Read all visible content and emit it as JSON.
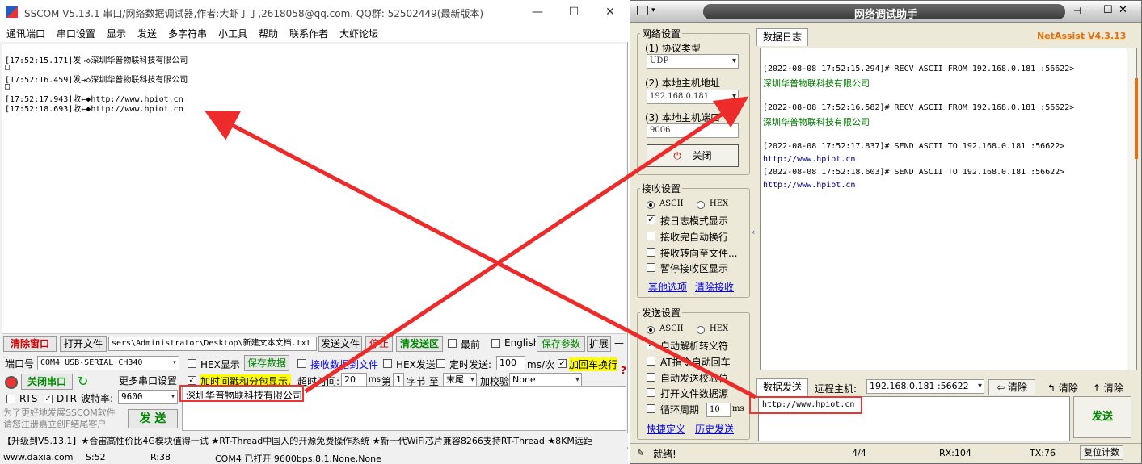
{
  "sscom": {
    "title": "SSCOM V5.13.1 串口/网络数据调试器,作者:大虾丁丁,2618058@qq.com. QQ群: 52502449(最新版本)",
    "menu": [
      "通讯端口",
      "串口设置",
      "显示",
      "发送",
      "多字符串",
      "小工具",
      "帮助",
      "联系作者",
      "大虾论坛"
    ],
    "recv_lines": [
      "[17:52:15.171]发→◇深圳华普物联科技有限公司",
      "□",
      "[17:52:16.459]发→◇深圳华普物联科技有限公司",
      "□",
      "[17:52:17.943]收←◆http://www.hpiot.cn",
      "[17:52:18.693]收←◆http://www.hpiot.cn"
    ],
    "toolbar": {
      "clear_window": "清除窗口",
      "open_file": "打开文件",
      "file_path": "sers\\Administrator\\Desktop\\新建文本文档.txt",
      "send_file": "发送文件",
      "stop": "停止",
      "clear_send": "清发送区",
      "topmost": "最前",
      "english": "English",
      "save_params": "保存参数",
      "expand": "扩展",
      "dash": "—"
    },
    "port": {
      "label": "端口号",
      "value": "COM4 USB-SERIAL CH340",
      "close_port": "关闭串口",
      "more_settings": "更多串口设置",
      "rts": "RTS",
      "dtr": "DTR",
      "baud_label": "波特率:",
      "baud": "9600"
    },
    "options": {
      "hex_display": "HEX显示",
      "save_data": "保存数据",
      "recv_to_file": "接收数据到文件",
      "hex_send": "HEX发送",
      "timed_send": "定时发送:",
      "timed_value": "100",
      "ms_per": "ms/次",
      "add_crlf": "加回车换行",
      "add_timestamp": "加时间戳和分包显示,",
      "timeout_label": "超时时间:",
      "timeout_value": "20",
      "ms": "ms",
      "nth": "第",
      "byte_n": "1",
      "byte_to": "字节 至",
      "end": "末尾",
      "checksum": "加校验",
      "checksum_value": "None",
      "question": "?"
    },
    "send_text": "深圳华普物联科技有限公司",
    "promo_left": "为了更好地发展SSCOM软件\n请您注册嘉立创F结尾客户",
    "send_button": "发 送",
    "ticker": "【升级到V5.13.1】★合宙高性价比4G模块值得一试 ★RT-Thread中国人的开源免费操作系统 ★新一代WiFi芯片兼容8266支持RT-Thread ★8KM远距",
    "status": {
      "site": "www.daxia.com",
      "s": "S:52",
      "r": "R:38",
      "port_state": "COM4 已打开  9600bps,8,1,None,None"
    }
  },
  "netassist": {
    "title": "网络调试助手",
    "net_settings": {
      "group": "网络设置",
      "protocol_label": "(1) 协议类型",
      "protocol": "UDP",
      "host_label": "(2) 本地主机地址",
      "host": "192.168.0.181",
      "port_label": "(3) 本地主机端口",
      "port": "9006",
      "close": "关闭"
    },
    "recv_settings": {
      "group": "接收设置",
      "ascii": "ASCII",
      "hex": "HEX",
      "log_mode": "按日志模式显示",
      "auto_newline": "接收完自动换行",
      "to_file": "接收转向至文件...",
      "pause": "暂停接收区显示",
      "more": "其他选项",
      "clear": "清除接收"
    },
    "send_settings": {
      "group": "发送设置",
      "ascii": "ASCII",
      "hex": "HEX",
      "escape": "自动解析转义符",
      "at_newline": "AT指令自动回车",
      "checksum": "自动发送校验位",
      "open_file": "打开文件数据源",
      "cycle": "循环周期",
      "cycle_value": "10",
      "ms": "ms",
      "shortcut": "快捷定义",
      "history": "历史发送"
    },
    "log_tab": "数据日志",
    "version": "NetAssist V4.3.13",
    "log_lines": [
      {
        "text": "[2022-08-08 17:52:15.294]# RECV ASCII FROM 192.168.0.181 :56622>",
        "color": "#333333"
      },
      {
        "text": "深圳华普物联科技有限公司",
        "color": "#008000"
      },
      {
        "text": "[2022-08-08 17:52:16.582]# RECV ASCII FROM 192.168.0.181 :56622>",
        "color": "#333333"
      },
      {
        "text": "深圳华普物联科技有限公司",
        "color": "#008000"
      },
      {
        "text": "[2022-08-08 17:52:17.837]# SEND ASCII TO 192.168.0.181 :56622>",
        "color": "#333333"
      },
      {
        "text": "http://www.hpiot.cn",
        "color": "#000080"
      },
      {
        "text": "[2022-08-08 17:52:18.603]# SEND ASCII TO 192.168.0.181 :56622>",
        "color": "#333333"
      },
      {
        "text": "http://www.hpiot.cn",
        "color": "#000080"
      }
    ],
    "send_tab": "数据发送",
    "remote_label": "远程主机:",
    "remote_value": "192.168.0.181 :56622",
    "clear1": "清除",
    "clear2": "清除",
    "clear3": "清除",
    "send_text": "http://www.hpiot.cn",
    "send_button": "发送",
    "status": {
      "ready": "就绪!",
      "count": "4/4",
      "rx": "RX:104",
      "tx": "TX:76",
      "reset": "复位计数"
    }
  }
}
